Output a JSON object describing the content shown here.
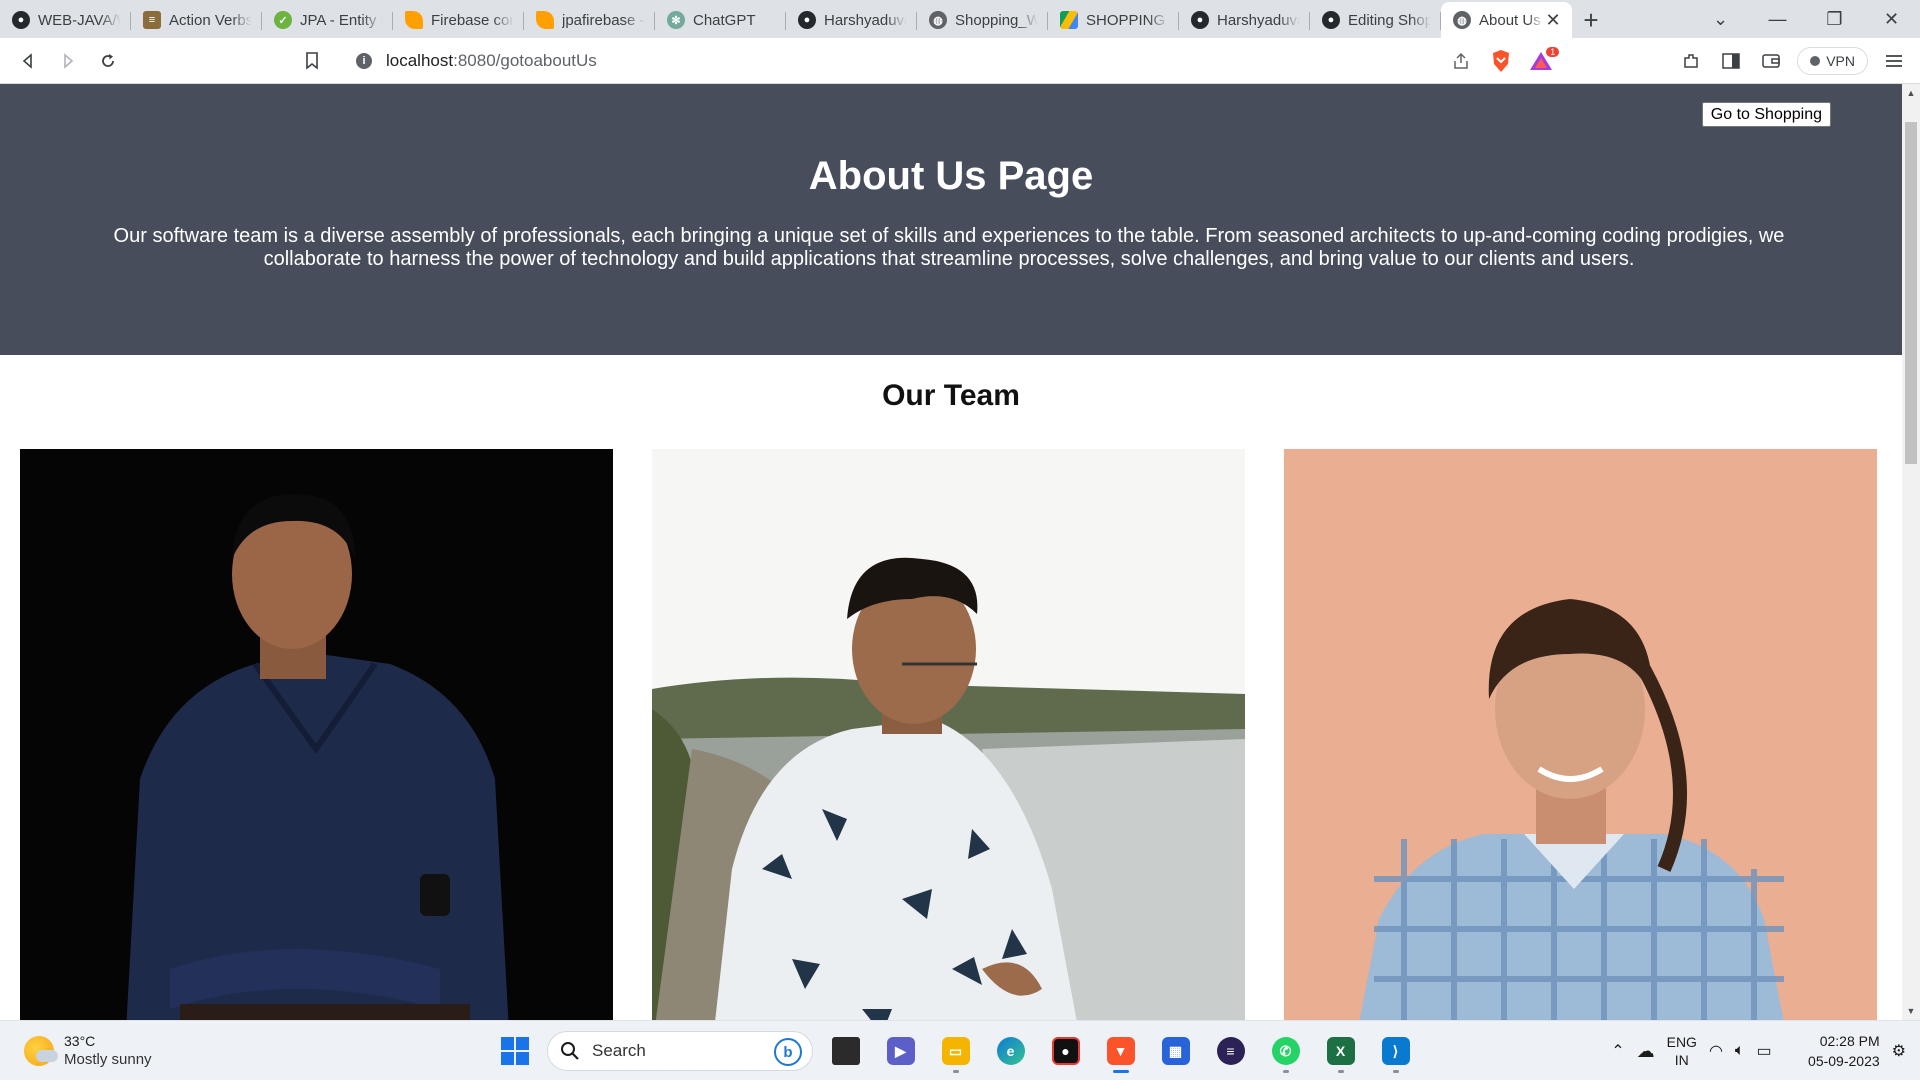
{
  "browser": {
    "tabs": [
      {
        "label": "WEB-JAVA/W",
        "icon": "github-icon",
        "color": "#24292e"
      },
      {
        "label": "Action Verbs",
        "icon": "page-icon",
        "color": "#8a6d3b"
      },
      {
        "label": "JPA - Entity R",
        "icon": "leaf-icon",
        "color": "#6db33f"
      },
      {
        "label": "Firebase con",
        "icon": "firebase-icon",
        "color": "#ffa000"
      },
      {
        "label": "jpafirebase -",
        "icon": "firebase-icon",
        "color": "#ffa000"
      },
      {
        "label": "ChatGPT",
        "icon": "chatgpt-icon",
        "color": "#74aa9c"
      },
      {
        "label": "Harshyaduva",
        "icon": "github-icon",
        "color": "#24292e"
      },
      {
        "label": "Shopping_W",
        "icon": "globe-icon",
        "color": "#5f6368"
      },
      {
        "label": "SHOPPING A",
        "icon": "drive-icon",
        "color": "#fbbc04"
      },
      {
        "label": "Harshyaduva",
        "icon": "github-icon",
        "color": "#24292e"
      },
      {
        "label": "Editing Shop",
        "icon": "github-icon",
        "color": "#24292e"
      },
      {
        "label": "About Us",
        "icon": "globe-icon",
        "color": "#5f6368",
        "active": true
      }
    ],
    "new_tab": "+",
    "url_host": "localhost",
    "url_path": ":8080/gotoaboutUs",
    "vpn_label": "VPN",
    "brave_badge": "1"
  },
  "page": {
    "shop_button": "Go to Shopping",
    "title": "About Us Page",
    "description": "Our software team is a diverse assembly of professionals, each bringing a unique set of skills and experiences to the table. From seasoned architects to up-and-coming coding prodigies, we collaborate to harness the power of technology and build applications that streamline processes, solve challenges, and bring value to our clients and users.",
    "team_title": "Our Team",
    "hero_color": "#474d5b"
  },
  "taskbar": {
    "weather_temp": "33°C",
    "weather_desc": "Mostly sunny",
    "search_label": "Search",
    "lang_line1": "ENG",
    "lang_line2": "IN",
    "time": "02:28 PM",
    "date": "05-09-2023"
  }
}
